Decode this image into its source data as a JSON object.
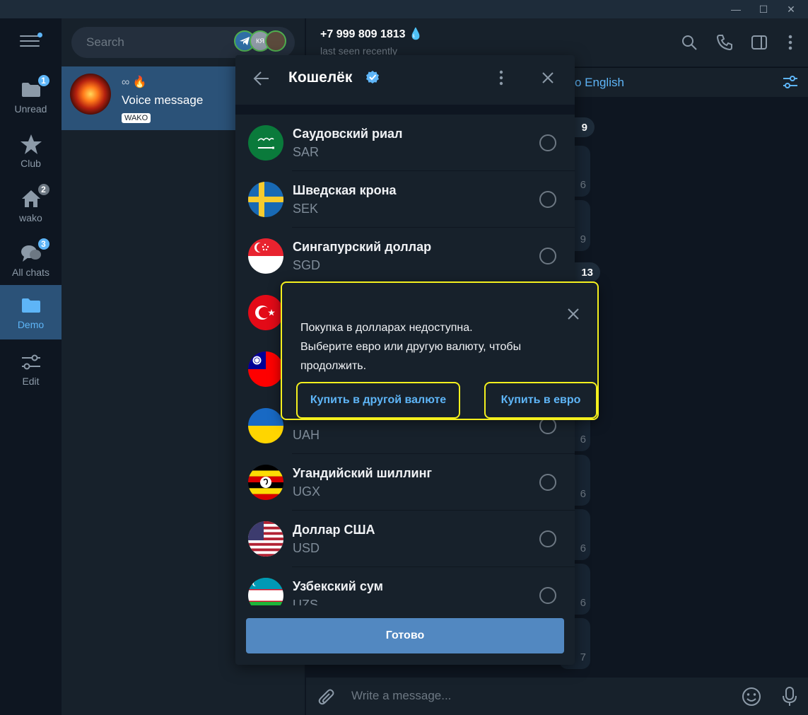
{
  "window": {
    "minimize_glyph": "—",
    "maximize_glyph": "☐",
    "close_glyph": "✕"
  },
  "rail": {
    "folders": [
      {
        "label": "Unread",
        "icon": "folder-icon",
        "badge": "1"
      },
      {
        "label": "Club",
        "icon": "star-icon",
        "badge": ""
      },
      {
        "label": "wako",
        "icon": "home-icon",
        "badge": "2"
      },
      {
        "label": "All chats",
        "icon": "chats-icon",
        "badge": "3"
      },
      {
        "label": "Demo",
        "icon": "folder-icon",
        "badge": ""
      },
      {
        "label": "Edit",
        "icon": "sliders-icon",
        "badge": ""
      }
    ],
    "active": "Demo"
  },
  "chatlist": {
    "search_placeholder": "Search",
    "story_label": "КЯ",
    "chat": {
      "name": "∞ 🔥",
      "last_message": "Voice message",
      "tag": "WAKO"
    }
  },
  "chat": {
    "title": "+7 999 809 1813 💧",
    "status": "last seen recently",
    "translate_label": "o English",
    "composer_placeholder": "Write a message...",
    "date_chips": [
      "9",
      "13"
    ],
    "bubble_times": [
      "6",
      "9",
      "6",
      "6",
      "6",
      "6",
      "7"
    ]
  },
  "wallet": {
    "title": "Кошелёк",
    "currencies": [
      {
        "name": "Саудовский риал",
        "code": "SAR",
        "flag": "sa"
      },
      {
        "name": "Шведская крона",
        "code": "SEK",
        "flag": "se"
      },
      {
        "name": "Сингапурский доллар",
        "code": "SGD",
        "flag": "sg"
      },
      {
        "name": "",
        "code": "",
        "flag": "tr"
      },
      {
        "name": "",
        "code": "",
        "flag": "tw"
      },
      {
        "name": "",
        "code": "UAH",
        "flag": "ua"
      },
      {
        "name": "Угандийский шиллинг",
        "code": "UGX",
        "flag": "ug"
      },
      {
        "name": "Доллар США",
        "code": "USD",
        "flag": "us"
      },
      {
        "name": "Узбекский сум",
        "code": "UZS",
        "flag": "uz"
      }
    ],
    "done_label": "Готово"
  },
  "popup": {
    "line1": "Покупка в долларах недоступна.",
    "line2": "Выберите евро или другую валюту, чтобы",
    "line3": "продолжить.",
    "btn_other": "Купить в другой валюте",
    "btn_euro": "Купить в евро",
    "highlight_color": "#f4f01e"
  },
  "colors": {
    "accent": "#5eb5f7",
    "selected_folder": "#2b5278",
    "panel": "#17212b",
    "background": "#0e1621",
    "button": "#5288c1"
  }
}
